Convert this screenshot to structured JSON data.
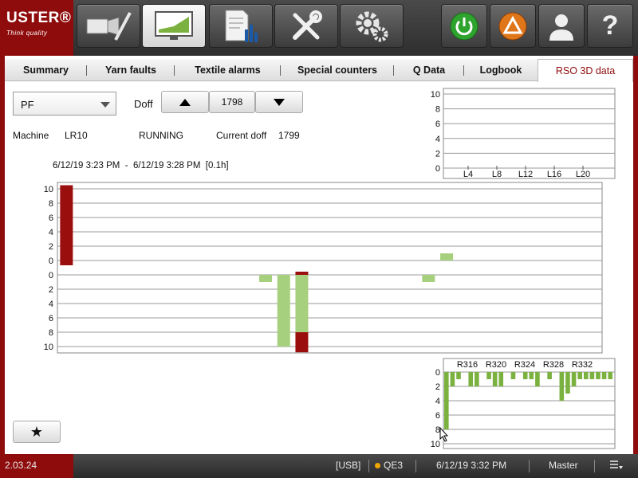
{
  "logo": {
    "brand": "USTER®",
    "tagline": "Think quality"
  },
  "nav": {
    "left": [
      "gauge-icon",
      "monitor-chart-icon",
      "report-icon",
      "tools-icon",
      "settings-icon"
    ],
    "right": [
      "power-icon",
      "alarm-icon",
      "user-icon",
      "help-icon"
    ],
    "active": "monitor-chart-icon",
    "help_label": "?",
    "colors": {
      "power": "#2ea32e",
      "alarm": "#e0761a",
      "accent": "#8f0c0c"
    }
  },
  "tabs": [
    "Summary",
    "Yarn faults",
    "Textile alarms",
    "Special counters",
    "Q Data",
    "Logbook",
    "RSO 3D data"
  ],
  "active_tab": "RSO 3D data",
  "controls": {
    "select_value": "PF",
    "doff_label": "Doff",
    "doff_value": "1798"
  },
  "info": {
    "machine_label": "Machine",
    "machine_value": "LR10",
    "state": "RUNNING",
    "current_doff_label": "Current doff",
    "current_doff_value": "1799",
    "time_range": "6/12/19 3:23 PM  -  6/12/19 3:28 PM  [0.1h]"
  },
  "chart_data": [
    {
      "type": "bar",
      "id": "top-right-chart",
      "xlabel_ticks": [
        "L4",
        "L8",
        "L12",
        "L16",
        "L20"
      ],
      "yticks": [
        0,
        2,
        4,
        6,
        8,
        10
      ],
      "ylim": [
        0,
        10
      ],
      "values": []
    },
    {
      "type": "bar",
      "id": "main-chart",
      "upper": {
        "yticks": [
          0,
          2,
          4,
          6,
          8,
          10
        ],
        "ylim": [
          0,
          10
        ],
        "bars": [
          {
            "pos": 0.5,
            "value": 10.5,
            "color": "#9b0e0e"
          },
          {
            "pos": 21.5,
            "value": 1,
            "color": "#a7d07e"
          }
        ]
      },
      "lower": {
        "yticks": [
          0,
          2,
          4,
          6,
          8,
          10
        ],
        "ylim": [
          0,
          10
        ],
        "bars": [
          {
            "pos": 11.5,
            "value": 1,
            "color": "#a7d07e"
          },
          {
            "pos": 12.5,
            "value": 10,
            "color": "#a7d07e"
          },
          {
            "pos": 13.5,
            "value": 8,
            "color": "#a7d07e",
            "stack": 2.8,
            "stack_color": "#9b0e0e"
          },
          {
            "pos": 20.5,
            "value": 1,
            "color": "#a7d07e"
          }
        ]
      },
      "slots": 31
    },
    {
      "type": "bar",
      "id": "bottom-right-chart",
      "xlabel_ticks": [
        "R316",
        "R320",
        "R324",
        "R328",
        "R332"
      ],
      "yticks": [
        0,
        2,
        4,
        6,
        8,
        10
      ],
      "ylim": [
        0,
        10
      ],
      "values": [
        8,
        2,
        1,
        0,
        2,
        2,
        0,
        1,
        2,
        2,
        0,
        1,
        0,
        1,
        1,
        2,
        0,
        1,
        0,
        4,
        3,
        2,
        1,
        1,
        1,
        1,
        1,
        1
      ]
    }
  ],
  "favorite_icon": "star-icon",
  "favorite_glyph": "★",
  "status": {
    "version": "2.03.24",
    "usb": "[USB]",
    "group": "QE3",
    "datetime": "6/12/19 3:32 PM",
    "user": "Master",
    "menu_icon": "list-menu-icon"
  }
}
